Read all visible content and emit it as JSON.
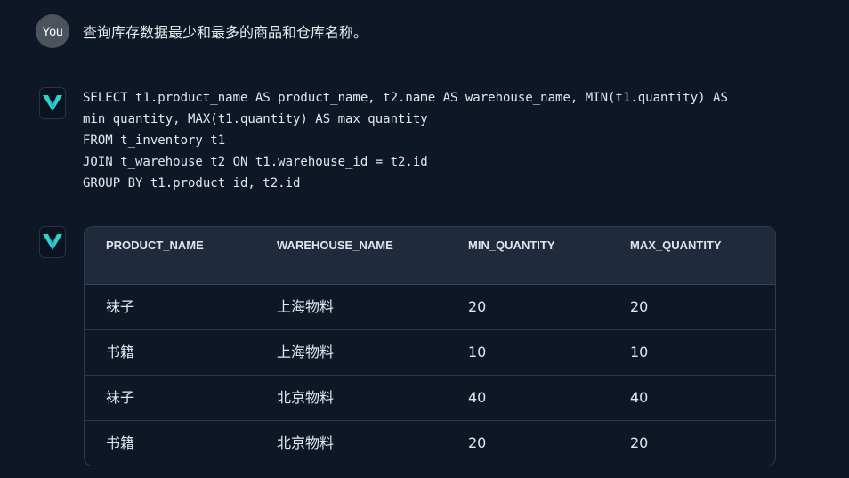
{
  "user": {
    "avatar_label": "You",
    "message": "查询库存数据最少和最多的商品和仓库名称。"
  },
  "assistant": {
    "sql_lines": [
      "SELECT t1.product_name AS product_name, t2.name AS warehouse_name, MIN(t1.quantity) AS",
      "min_quantity, MAX(t1.quantity) AS max_quantity",
      "FROM t_inventory t1",
      "JOIN t_warehouse t2 ON t1.warehouse_id = t2.id",
      "GROUP BY t1.product_id, t2.id"
    ],
    "table": {
      "headers": [
        "PRODUCT_NAME",
        "WAREHOUSE_NAME",
        "MIN_QUANTITY",
        "MAX_QUANTITY"
      ],
      "rows": [
        [
          "袜子",
          "上海物料",
          "20",
          "20"
        ],
        [
          "书籍",
          "上海物料",
          "10",
          "10"
        ],
        [
          "袜子",
          "北京物料",
          "40",
          "40"
        ],
        [
          "书籍",
          "北京物料",
          "20",
          "20"
        ]
      ]
    }
  },
  "colors": {
    "background": "#0e1726",
    "logo_teal": "#2fd3c4",
    "logo_blue": "#2f8fea"
  },
  "icons": {
    "user_avatar": "user-avatar",
    "assistant_avatar": "v-logo-icon"
  }
}
